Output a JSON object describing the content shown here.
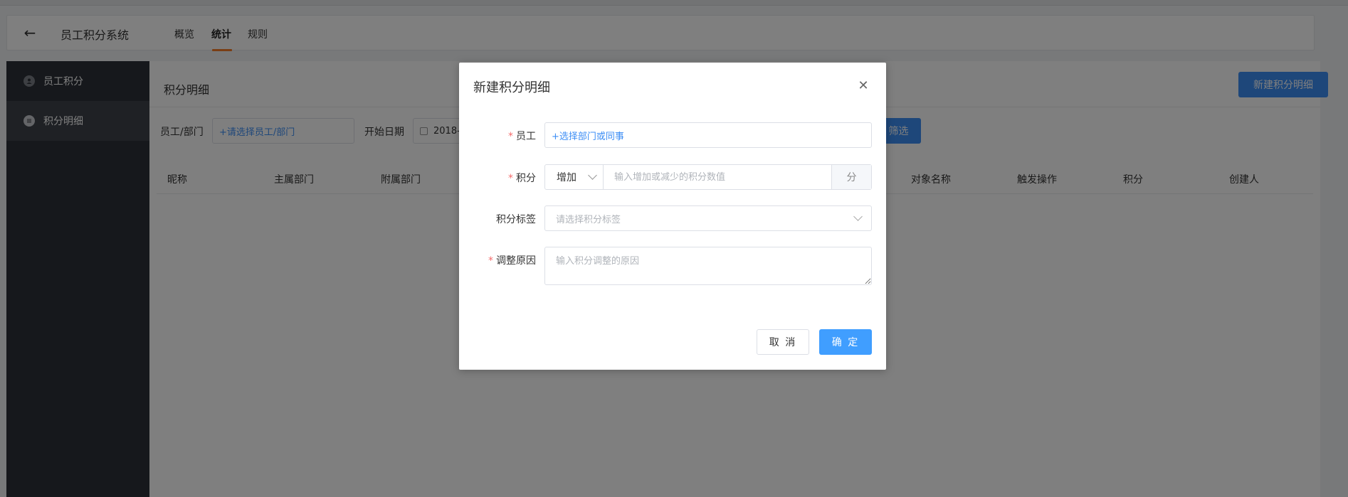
{
  "header": {
    "app_title": "员工积分系统",
    "tabs": [
      {
        "label": "概览"
      },
      {
        "label": "统计"
      },
      {
        "label": "规则"
      }
    ],
    "active_tab": "统计",
    "accent_color": "#f57c28"
  },
  "sidebar": {
    "items": [
      {
        "label": "员工积分",
        "icon": "user-icon"
      },
      {
        "label": "积分明细",
        "icon": "list-icon"
      }
    ],
    "active_item": "积分明细"
  },
  "main": {
    "title": "积分明细",
    "new_button_label": "新建积分明细",
    "filters": {
      "employee_label": "员工/部门",
      "employee_placeholder": "+请选择员工/部门",
      "start_date_label": "开始日期",
      "start_date_value": "2018-",
      "filter_button_label": "筛选"
    },
    "table_headers": [
      "昵称",
      "主属部门",
      "附属部门",
      "对象名称",
      "触发操作",
      "积分",
      "创建人"
    ]
  },
  "modal": {
    "title": "新建积分明细",
    "fields": {
      "employee": {
        "label": "员工",
        "value": "+选择部门或同事"
      },
      "points": {
        "label": "积分",
        "mode": "增加",
        "placeholder": "输入增加或减少的积分数值",
        "suffix": "分"
      },
      "tag": {
        "label": "积分标签",
        "placeholder": "请选择积分标签"
      },
      "reason": {
        "label": "调整原因",
        "placeholder": "输入积分调整的原因"
      }
    },
    "cancel_label": "取 消",
    "ok_label": "确 定",
    "primary_color": "#409eff"
  }
}
